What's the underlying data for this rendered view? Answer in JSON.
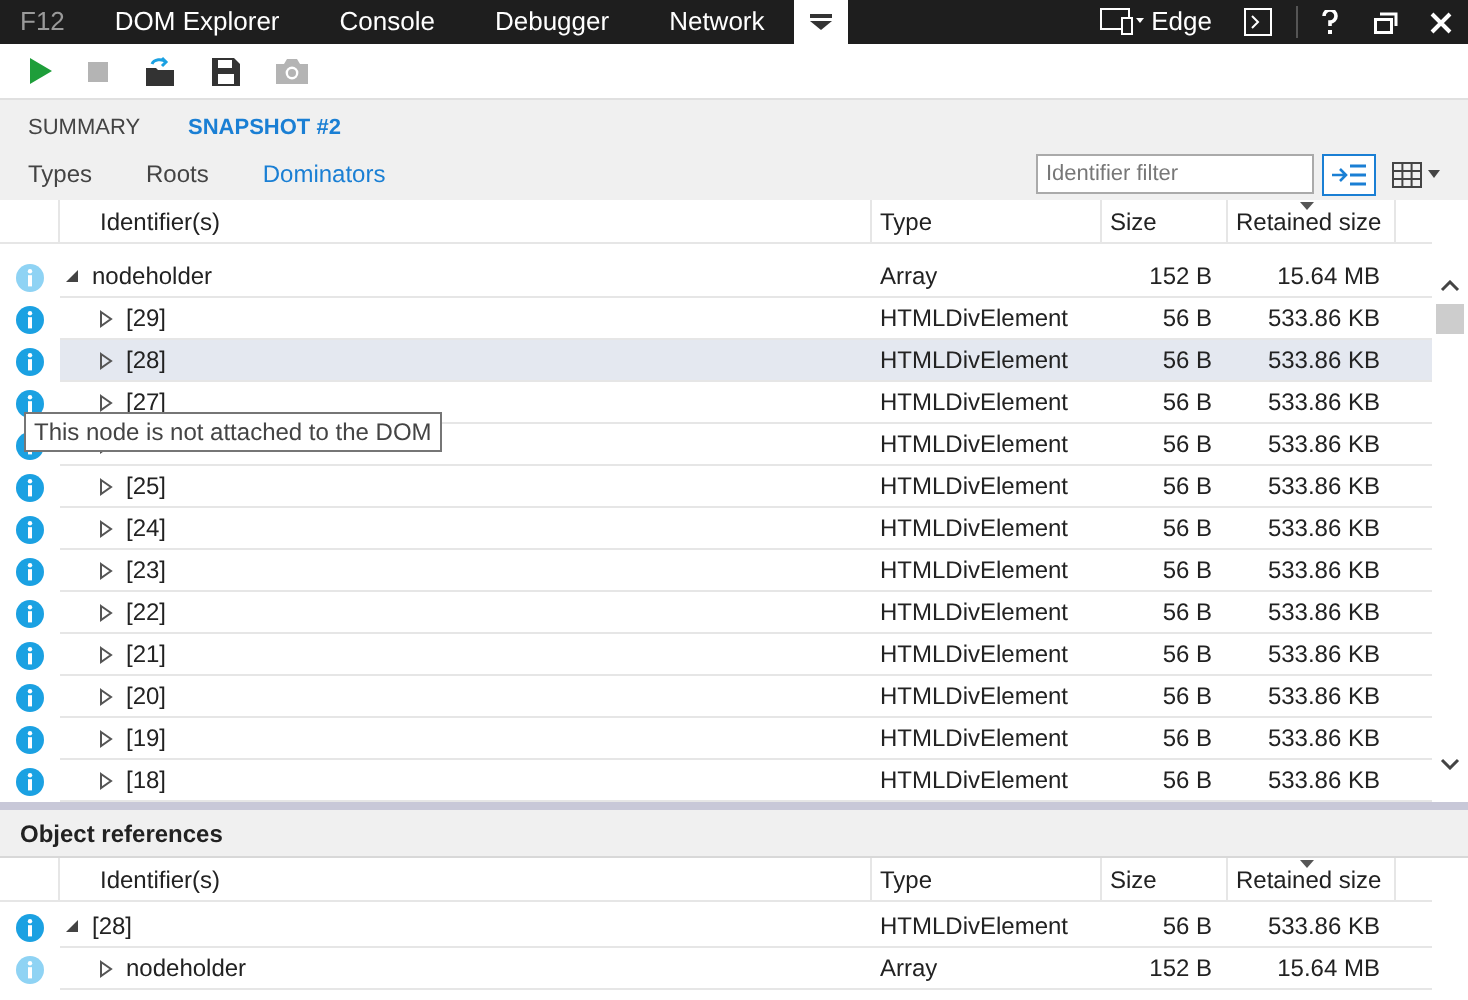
{
  "f12_label": "F12",
  "tabs": [
    {
      "label": "DOM Explorer",
      "selected": false
    },
    {
      "label": "Console",
      "selected": false
    },
    {
      "label": "Debugger",
      "selected": false
    },
    {
      "label": "Network",
      "selected": false
    }
  ],
  "overflow_menu_open": true,
  "browser_target": "Edge",
  "toolbar": [
    {
      "kind": "play",
      "disabled": false
    },
    {
      "kind": "stop",
      "disabled": true
    },
    {
      "kind": "import",
      "disabled": false
    },
    {
      "kind": "save",
      "disabled": false
    },
    {
      "kind": "camera",
      "disabled": true
    }
  ],
  "views": [
    {
      "label": "SUMMARY",
      "selected": false
    },
    {
      "label": "SNAPSHOT #2",
      "selected": true
    }
  ],
  "subviews": [
    {
      "label": "Types",
      "selected": false
    },
    {
      "label": "Roots",
      "selected": false
    },
    {
      "label": "Dominators",
      "selected": true
    }
  ],
  "filter": {
    "placeholder": "Identifier filter"
  },
  "tree_view_toggle": {
    "pressed": true
  },
  "columns": [
    {
      "label": "Identifier(s)",
      "sorted": false
    },
    {
      "label": "Type",
      "sorted": false
    },
    {
      "label": "Size",
      "sorted": false
    },
    {
      "label": "Retained size",
      "sorted": true
    }
  ],
  "rows": [
    {
      "identifier": "nodeholder",
      "type": "Array",
      "size": "152 B",
      "retained": "15.64 MB",
      "info_dim": true,
      "expanded": true,
      "selected": false,
      "children": [
        {
          "identifier": "[29]",
          "type": "HTMLDivElement",
          "size": "56 B",
          "retained": "533.86 KB",
          "info_dim": false,
          "expanded": false,
          "selected": false
        },
        {
          "identifier": "[28]",
          "type": "HTMLDivElement",
          "size": "56 B",
          "retained": "533.86 KB",
          "info_dim": false,
          "expanded": false,
          "selected": true
        },
        {
          "identifier": "[27]",
          "type": "HTMLDivElement",
          "size": "56 B",
          "retained": "533.86 KB",
          "info_dim": false,
          "expanded": false,
          "selected": false
        },
        {
          "type": "HTMLDivElement",
          "size": "56 B",
          "retained": "533.86 KB",
          "info_dim": false,
          "expanded": false,
          "selected": false
        },
        {
          "identifier": "[25]",
          "type": "HTMLDivElement",
          "size": "56 B",
          "retained": "533.86 KB",
          "info_dim": false,
          "expanded": false,
          "selected": false
        },
        {
          "identifier": "[24]",
          "type": "HTMLDivElement",
          "size": "56 B",
          "retained": "533.86 KB",
          "info_dim": false,
          "expanded": false,
          "selected": false
        },
        {
          "identifier": "[23]",
          "type": "HTMLDivElement",
          "size": "56 B",
          "retained": "533.86 KB",
          "info_dim": false,
          "expanded": false,
          "selected": false
        },
        {
          "identifier": "[22]",
          "type": "HTMLDivElement",
          "size": "56 B",
          "retained": "533.86 KB",
          "info_dim": false,
          "expanded": false,
          "selected": false
        },
        {
          "identifier": "[21]",
          "type": "HTMLDivElement",
          "size": "56 B",
          "retained": "533.86 KB",
          "info_dim": false,
          "expanded": false,
          "selected": false
        },
        {
          "identifier": "[20]",
          "type": "HTMLDivElement",
          "size": "56 B",
          "retained": "533.86 KB",
          "info_dim": false,
          "expanded": false,
          "selected": false
        },
        {
          "identifier": "[19]",
          "type": "HTMLDivElement",
          "size": "56 B",
          "retained": "533.86 KB",
          "info_dim": false,
          "expanded": false,
          "selected": false
        },
        {
          "identifier": "[18]",
          "type": "HTMLDivElement",
          "size": "56 B",
          "retained": "533.86 KB",
          "info_dim": false,
          "expanded": false,
          "selected": false
        }
      ]
    }
  ],
  "tooltip": "This node is not attached to the DOM",
  "references": {
    "title": "Object references",
    "columns": [
      {
        "label": "Identifier(s)",
        "sorted": false
      },
      {
        "label": "Type",
        "sorted": false
      },
      {
        "label": "Size",
        "sorted": false
      },
      {
        "label": "Retained size",
        "sorted": true
      }
    ],
    "rows": [
      {
        "identifier": "[28]",
        "type": "HTMLDivElement",
        "size": "56 B",
        "retained": "533.86 KB",
        "info_dim": false,
        "expanded": true,
        "selected": false,
        "children": [
          {
            "identifier": "nodeholder",
            "type": "Array",
            "size": "152 B",
            "retained": "15.64 MB",
            "info_dim": true,
            "expanded": false,
            "selected": false
          }
        ]
      }
    ]
  }
}
